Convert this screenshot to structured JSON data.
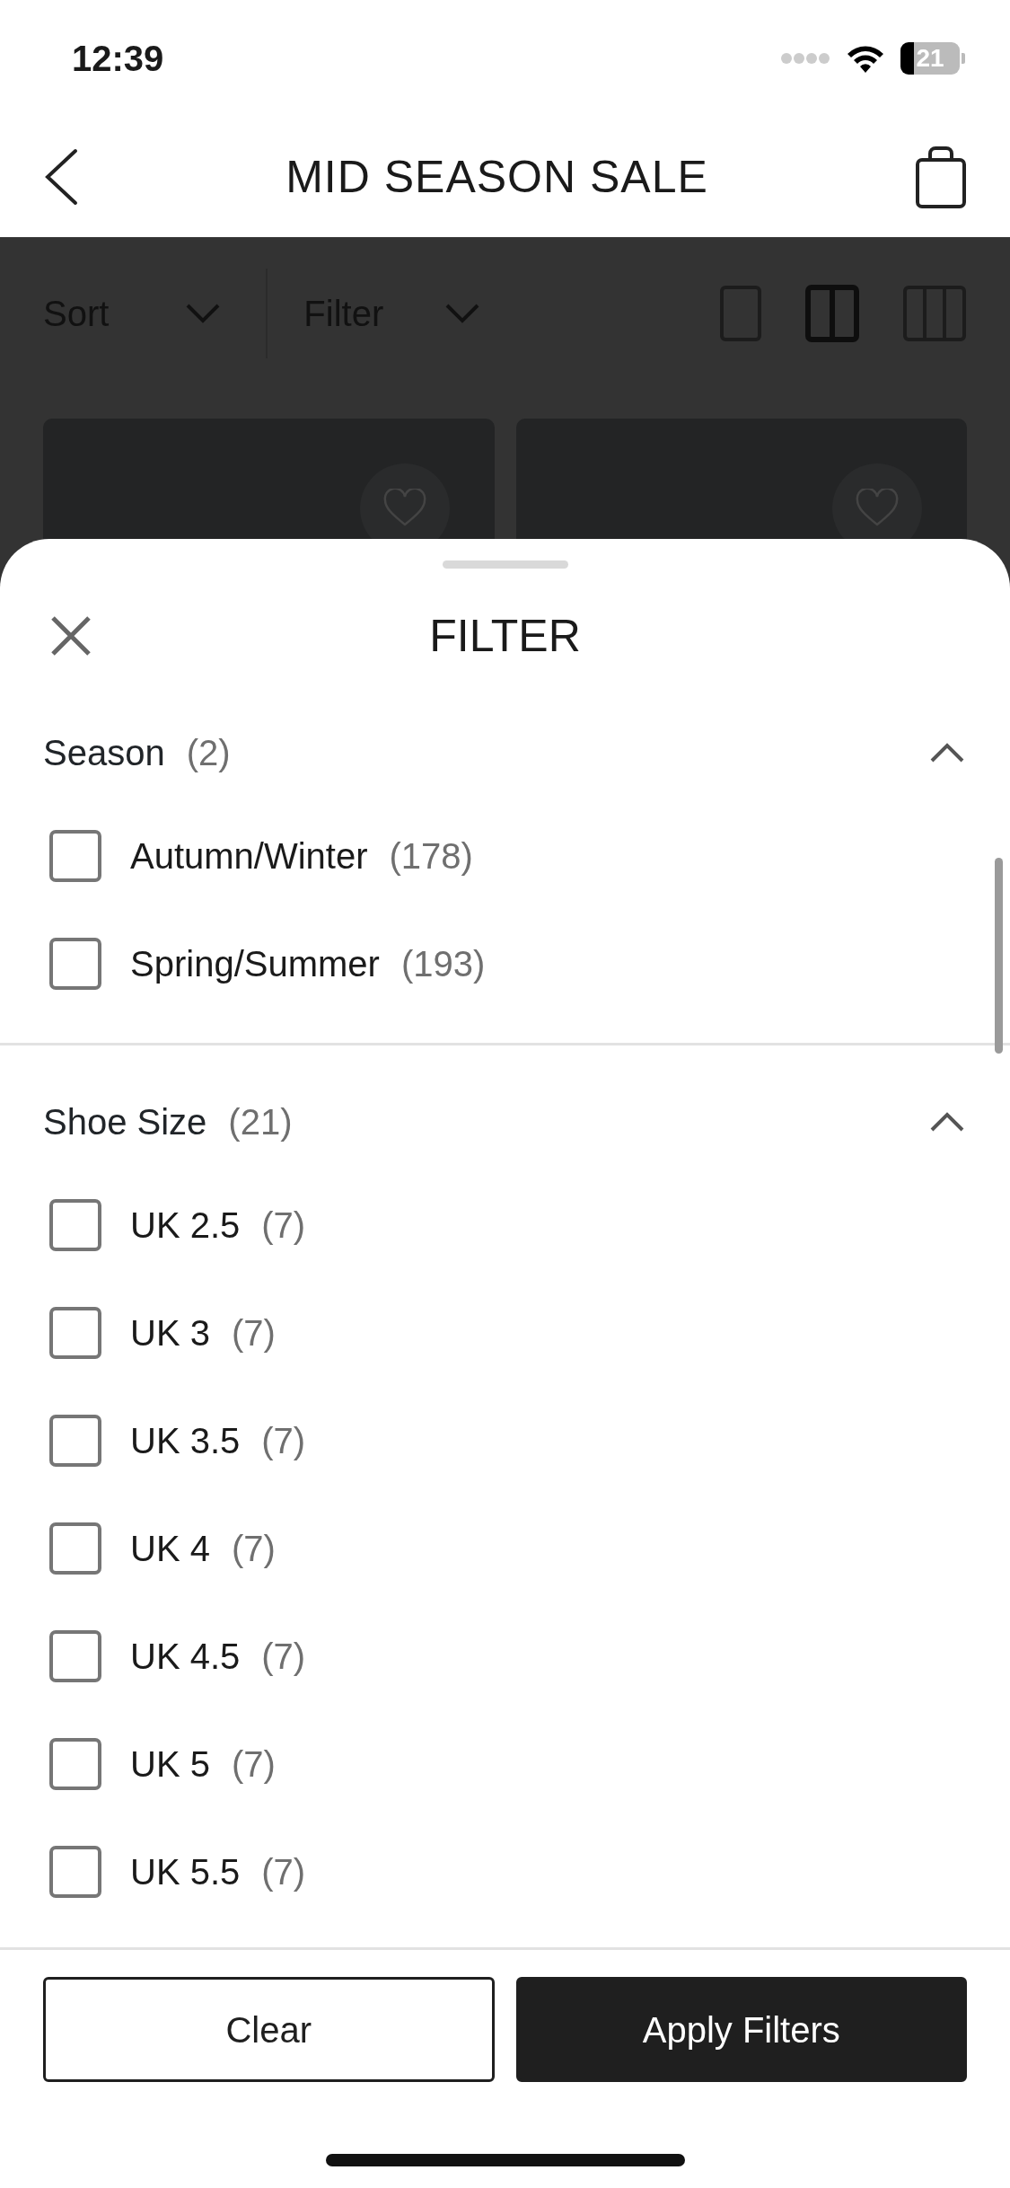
{
  "status_bar": {
    "time": "12:39",
    "battery": "21"
  },
  "header": {
    "title": "MID SEASON SALE"
  },
  "toolbar": {
    "items": [
      {
        "label": "Sort"
      },
      {
        "label": "Filter"
      }
    ],
    "layouts": [
      {
        "selected": false
      },
      {
        "selected": true
      },
      {
        "selected": false
      }
    ]
  },
  "product_cards": [
    {
      "favorite": false
    },
    {
      "favorite": false
    }
  ],
  "sheet": {
    "title": "FILTER",
    "sections": [
      {
        "title": "Season",
        "count": "(2)",
        "expanded": true,
        "options": [
          {
            "label": "Autumn/Winter",
            "count": "(178)",
            "checked": false
          },
          {
            "label": "Spring/Summer",
            "count": "(193)",
            "checked": false
          }
        ]
      },
      {
        "title": "Shoe Size",
        "count": "(21)",
        "expanded": true,
        "options": [
          {
            "label": "UK 2.5",
            "count": "(7)",
            "checked": false
          },
          {
            "label": "UK 3",
            "count": "(7)",
            "checked": false
          },
          {
            "label": "UK 3.5",
            "count": "(7)",
            "checked": false
          },
          {
            "label": "UK 4",
            "count": "(7)",
            "checked": false
          },
          {
            "label": "UK 4.5",
            "count": "(7)",
            "checked": false
          },
          {
            "label": "UK 5",
            "count": "(7)",
            "checked": false
          },
          {
            "label": "UK 5.5",
            "count": "(7)",
            "checked": false
          }
        ]
      }
    ],
    "buttons": [
      {
        "kind": "secondary",
        "label": "Clear"
      },
      {
        "kind": "primary",
        "label": "Apply Filters"
      }
    ]
  }
}
